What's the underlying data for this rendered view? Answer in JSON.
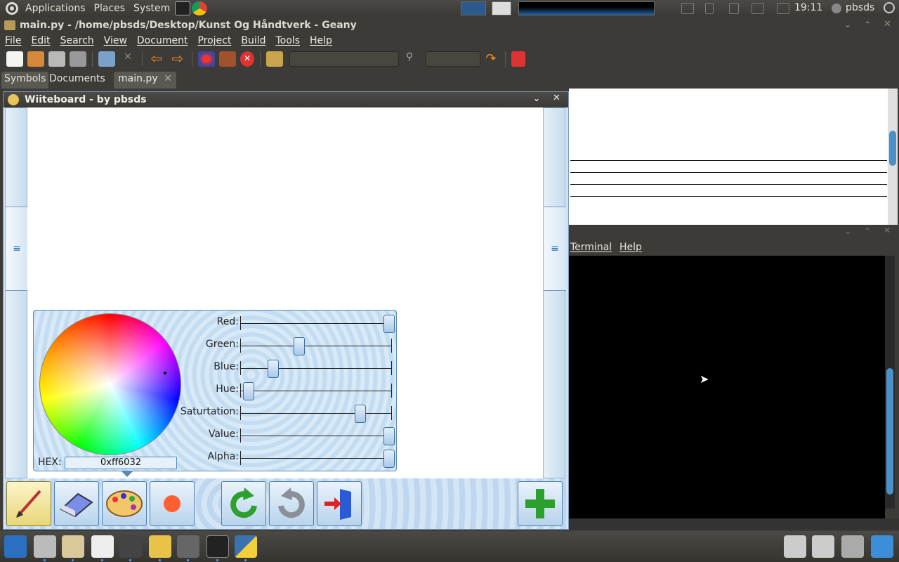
{
  "top_panel": {
    "menus": [
      "Applications",
      "Places",
      "System"
    ],
    "clock": "19:11",
    "user": "pbsds"
  },
  "geany": {
    "title": "main.py - /home/pbsds/Desktop/Kunst Og Håndtverk - Geany",
    "menu": [
      "File",
      "Edit",
      "Search",
      "View",
      "Document",
      "Project",
      "Build",
      "Tools",
      "Help"
    ],
    "sidebar_tabs": [
      "Symbols",
      "Documents"
    ],
    "doc_tab": "main.py",
    "terminal_menu": [
      "Terminal",
      "Help"
    ]
  },
  "wiiteboard": {
    "title": "Wiiteboard - by pbsds",
    "hex_label": "HEX:",
    "hex_value": "0xff6032",
    "sliders": [
      {
        "label": "Red:",
        "value": 1.0
      },
      {
        "label": "Green:",
        "value": 0.38
      },
      {
        "label": "Blue:",
        "value": 0.2
      },
      {
        "label": "Hue:",
        "value": 0.03
      },
      {
        "label": "Saturtation:",
        "value": 0.8
      },
      {
        "label": "Value:",
        "value": 1.0
      },
      {
        "label": "Alpha:",
        "value": 1.0
      }
    ],
    "current_color": "#ff6032",
    "tools": [
      "brush-icon",
      "eraser-icon",
      "palette-icon",
      "color-dot-icon",
      "undo-icon",
      "redo-icon",
      "exit-icon",
      "add-icon"
    ]
  },
  "colors": {
    "panel_bg": "#3c3b37",
    "accent": "#4a90c9",
    "wii_bg": "#cfe2f3"
  }
}
